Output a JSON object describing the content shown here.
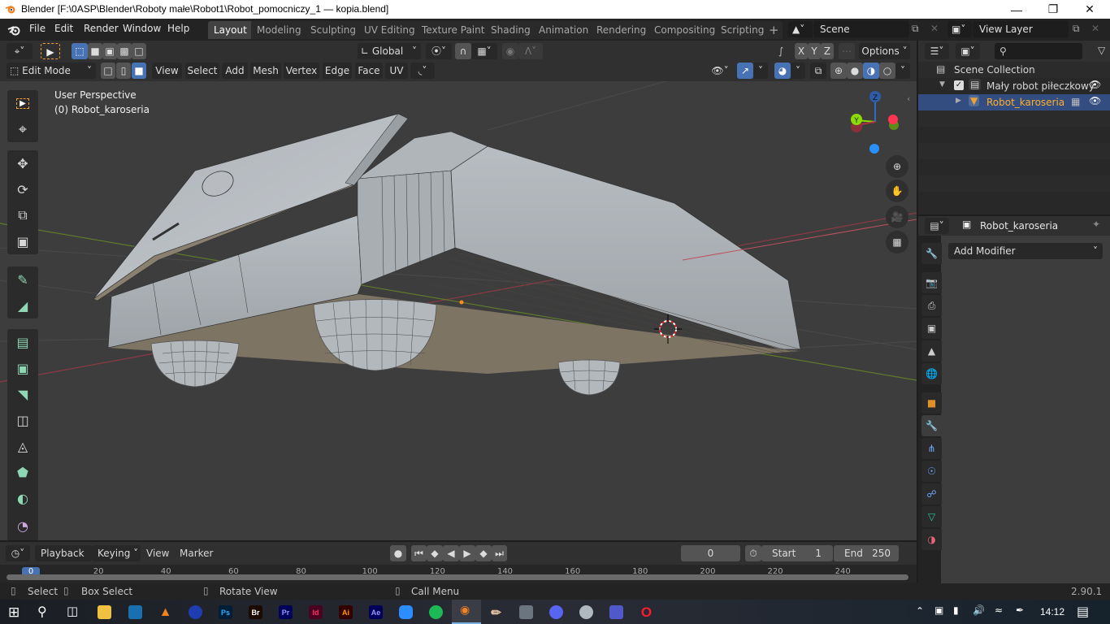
{
  "window": {
    "title": "Blender [F:\\0ASP\\Blender\\Roboty małe\\Robot1\\Robot_pomocniczy_1 — kopia.blend]",
    "controls": [
      "minimize",
      "maximize",
      "close"
    ]
  },
  "menubar": {
    "items": [
      "File",
      "Edit",
      "Render",
      "Window",
      "Help"
    ],
    "workspaces": [
      "Layout",
      "Modeling",
      "Sculpting",
      "UV Editing",
      "Texture Paint",
      "Shading",
      "Animation",
      "Rendering",
      "Compositing",
      "Scripting"
    ],
    "active_workspace": "Layout",
    "add_workspace": "+",
    "scene": "Scene",
    "view_layer": "View Layer"
  },
  "viewport_header": {
    "transform_orientation": "Global",
    "axes": [
      "X",
      "Y",
      "Z"
    ],
    "options_label": "Options",
    "mode": "Edit Mode",
    "menus": [
      "View",
      "Select",
      "Add",
      "Mesh",
      "Vertex",
      "Edge",
      "Face",
      "UV"
    ]
  },
  "viewport": {
    "view_name": "User Perspective",
    "object_label": "(0) Robot_karoseria",
    "gizmo_axes": [
      "X",
      "Y",
      "Z"
    ],
    "colors": {
      "x": "#ff3352",
      "y": "#8bdc00",
      "z": "#2890ff",
      "bg": "#3d3d3d",
      "mesh": "#a4a9af",
      "underside": "#7d7464"
    }
  },
  "toolbar": {
    "tools": [
      "select-box",
      "cursor",
      "move",
      "rotate",
      "scale",
      "transform",
      "annotate",
      "measure",
      "extrude",
      "inset",
      "bevel",
      "loop-cut",
      "knife",
      "poly-build",
      "spin",
      "smooth"
    ]
  },
  "outliner": {
    "search_placeholder": "",
    "root": "Scene Collection",
    "collection": "Mały robot piłeczkowy",
    "object": "Robot_karoseria"
  },
  "properties": {
    "object_name": "Robot_karoseria",
    "add_modifier_label": "Add Modifier",
    "tabs": [
      "tool",
      "render",
      "output",
      "view-layer",
      "scene",
      "world",
      "object",
      "modifiers",
      "particles",
      "physics",
      "constraints",
      "data",
      "material"
    ],
    "active_tab": "modifiers"
  },
  "timeline": {
    "menus": [
      "Playback",
      "Keying",
      "View",
      "Marker"
    ],
    "current_frame": "0",
    "start_label": "Start",
    "start": "1",
    "end_label": "End",
    "end": "250",
    "ruler_ticks": [
      "0",
      "20",
      "40",
      "60",
      "80",
      "100",
      "120",
      "140",
      "160",
      "180",
      "200",
      "220",
      "240"
    ]
  },
  "statusbar": {
    "hints": [
      {
        "icon": "mouse-left",
        "label": "Select"
      },
      {
        "icon": "mouse-drag",
        "label": "Box Select"
      },
      {
        "icon": "mouse-middle",
        "label": "Rotate View"
      },
      {
        "icon": "mouse-right",
        "label": "Call Menu"
      }
    ],
    "version": "2.90.1"
  },
  "taskbar": {
    "apps": [
      "Ps",
      "Br",
      "Pr",
      "Id",
      "Ai",
      "Ae"
    ],
    "time": "14:12"
  }
}
